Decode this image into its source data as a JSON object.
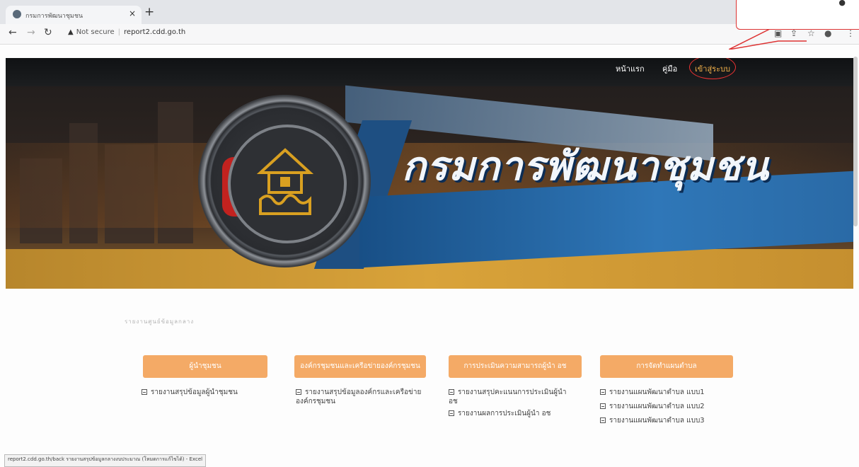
{
  "browser": {
    "tab_title": "กรมการพัฒนาชุมชน",
    "tab_close": "×",
    "new_tab": "+",
    "security": "Not secure",
    "url": "report2.cdd.go.th",
    "icons": [
      "back-icon",
      "forward-icon",
      "reload-icon",
      "warning-icon",
      "translate-icon",
      "share-icon",
      "star-icon",
      "profile-icon",
      "menu-icon"
    ]
  },
  "hero": {
    "title": "กรมการพัฒนาชุมชน",
    "menu": {
      "home": "หน้าแรก",
      "manual": "คู่มือ",
      "login": "เข้าสู่ระบบ"
    },
    "colors": {
      "accent": "#f4b24a",
      "banner_blue": "#2f77b8",
      "gold": "#d9a33a"
    }
  },
  "content": {
    "section_label": "รายงานศูนย์ข้อมูลกลาง",
    "columns": [
      {
        "header": "ผู้นำชุมชน",
        "links": [
          "รายงานสรุปข้อมูลผู้นำชุมชน"
        ]
      },
      {
        "header": "องค์กรชุมชนและเครือข่ายองค์กรชุมชน",
        "links": [
          "รายงานสรุปข้อมูลองค์กรและเครือข่ายองค์กรชุมชน"
        ]
      },
      {
        "header": "การประเมินความสามารถผู้นำ อช",
        "links": [
          "รายงานสรุปคะแนนการประเมินผู้นำ อช",
          "รายงานผลการประเมินผู้นำ อช"
        ]
      },
      {
        "header": "การจัดทำแผนตำบล",
        "links": [
          "รายงานแผนพัฒนาตำบล แบบ1",
          "รายงานแผนพัฒนาตำบล แบบ2",
          "รายงานแผนพัฒนาตำบล แบบ3"
        ]
      }
    ],
    "header_color": "#f4aa66"
  },
  "status_bar": "report2.cdd.go.th/back รายงานสรุปข้อมูลกลางงบประมาณ (โหมดการแก้ไขได้) - Excel"
}
